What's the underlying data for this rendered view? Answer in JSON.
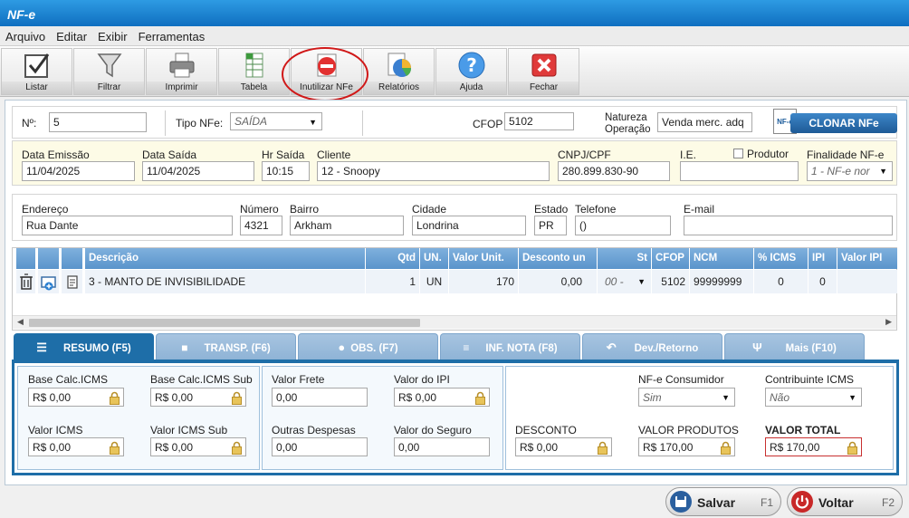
{
  "window": {
    "title": "NF-e"
  },
  "menu": [
    "Arquivo",
    "Editar",
    "Exibir",
    "Ferramentas"
  ],
  "toolbar": {
    "listar": "Listar",
    "filtrar": "Filtrar",
    "imprimir": "Imprimir",
    "tabela": "Tabela",
    "inutilizar": "Inutilizar NFe",
    "relatorios": "Relatórios",
    "ajuda": "Ajuda",
    "fechar": "Fechar"
  },
  "header": {
    "numero_label": "Nº:",
    "numero": "5",
    "tipo_label": "Tipo NFe:",
    "tipo": "SAÍDA",
    "cfop_label": "CFOP",
    "cfop": "5102",
    "natureza_label1": "Natureza",
    "natureza_label2": "Operação",
    "natureza": "Venda merc. adq",
    "clonar_badge": "NF-e",
    "clonar": "CLONAR NFe"
  },
  "dados": {
    "data_emissao_label": "Data Emissão",
    "data_emissao": "11/04/2025",
    "data_saida_label": "Data Saída",
    "data_saida": "11/04/2025",
    "hr_saida_label": "Hr Saída",
    "hr_saida": "10:15",
    "cliente_label": "Cliente",
    "cliente": "12 - Snoopy",
    "cnpj_label": "CNPJ/CPF",
    "cnpj": "280.899.830-90",
    "ie_label": "I.E.",
    "ie": "",
    "produtor_label": "Produtor",
    "finalidade_label": "Finalidade NF-e",
    "finalidade": "1 - NF-e nor"
  },
  "endereco": {
    "endereco_label": "Endereço",
    "endereco": "Rua Dante",
    "numero_label": "Número",
    "numero": "4321",
    "bairro_label": "Bairro",
    "bairro": "Arkham",
    "cidade_label": "Cidade",
    "cidade": "Londrina",
    "estado_label": "Estado",
    "estado": "PR",
    "telefone_label": "Telefone",
    "telefone": "()",
    "email_label": "E-mail",
    "email": ""
  },
  "items": {
    "columns": [
      "Descrição",
      "Qtd",
      "UN.",
      "Valor Unit.",
      "Desconto un",
      "St",
      "CFOP",
      "NCM",
      "% ICMS",
      "IPI",
      "Valor IPI"
    ],
    "rows": [
      {
        "descricao": "3 - MANTO DE INVISIBILIDADE",
        "qtd": "1",
        "un": "UN",
        "valor_unit": "170",
        "desconto": "0,00",
        "st": "00 -",
        "cfop": "5102",
        "ncm": "99999999",
        "icms": "0",
        "ipi": "0",
        "valor_ipi": ""
      }
    ]
  },
  "tabs": [
    "RESUMO (F5)",
    "TRANSP. (F6)",
    "OBS. (F7)",
    "INF. NOTA (F8)",
    "Dev./Retorno",
    "Mais (F10)"
  ],
  "resumo": {
    "base_icms_label": "Base Calc.ICMS",
    "base_icms": "R$ 0,00",
    "base_icms_sub_label": "Base Calc.ICMS Sub",
    "base_icms_sub": "R$ 0,00",
    "valor_icms_label": "Valor ICMS",
    "valor_icms": "R$ 0,00",
    "valor_icms_sub_label": "Valor ICMS Sub",
    "valor_icms_sub": "R$ 0,00",
    "valor_frete_label": "Valor Frete",
    "valor_frete": "0,00",
    "valor_ipi_label": "Valor do IPI",
    "valor_ipi": "R$ 0,00",
    "outras_label": "Outras Despesas",
    "outras": "0,00",
    "seguro_label": "Valor do Seguro",
    "seguro": "0,00",
    "consumidor_label": "NF-e Consumidor",
    "consumidor": "Sim",
    "contribuinte_label": "Contribuinte ICMS",
    "contribuinte": "Não",
    "desconto_label": "DESCONTO",
    "desconto": "R$ 0,00",
    "produtos_label": "VALOR PRODUTOS",
    "produtos": "R$ 170,00",
    "total_label": "VALOR TOTAL",
    "total": "R$ 170,00"
  },
  "footer": {
    "salvar": "Salvar",
    "salvar_key": "F1",
    "voltar": "Voltar",
    "voltar_key": "F2"
  },
  "colors": {
    "accent": "#1e6ea8",
    "header_grid": "#5a94cb",
    "highlight_row": "#fdfbe6",
    "alert": "#d01818"
  }
}
